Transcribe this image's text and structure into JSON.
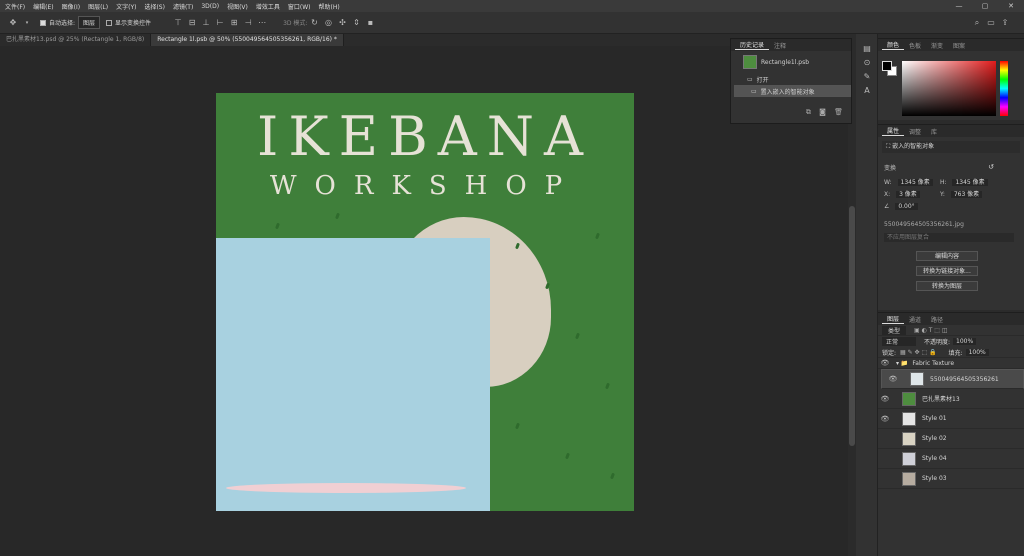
{
  "menu": [
    "文件(F)",
    "编辑(E)",
    "图像(I)",
    "图层(L)",
    "文字(Y)",
    "选择(S)",
    "滤镜(T)",
    "3D(D)",
    "视图(V)",
    "增效工具",
    "窗口(W)",
    "帮助(H)"
  ],
  "window_controls": [
    "—",
    "▢",
    "✕"
  ],
  "options": {
    "auto_select_label": "自动选择:",
    "auto_select_value": "图层",
    "show_transform_label": "显示变换控件",
    "mode_label": "3D 模式:"
  },
  "tabs": [
    {
      "label": "巴扎黑素材13.psd @ 25% (Rectangle 1, RGB/8)",
      "active": false
    },
    {
      "label": "Rectangle 1l.psb @ 50% (550049564505356261, RGB/16) *",
      "active": true
    }
  ],
  "canvas": {
    "title_line1": "IKEBANA",
    "title_line2": "WORKSHOP"
  },
  "history": {
    "tabs": [
      "历史记录",
      "注释"
    ],
    "snapshot": "Rectangle1l.psb",
    "items": [
      "打开",
      "置入嵌入的智能对象"
    ]
  },
  "color_panel": {
    "tabs": [
      "颜色",
      "色板",
      "渐变",
      "图案"
    ]
  },
  "properties": {
    "tabs": [
      "属性",
      "调整",
      "库"
    ],
    "type_label": "嵌入的智能对象",
    "section": "变换",
    "w_label": "W:",
    "w_value": "1345 像素",
    "h_label": "H:",
    "h_value": "1345 像素",
    "x_label": "X:",
    "x_value": "3 像素",
    "y_label": "Y:",
    "y_value": "763 像素",
    "angle_value": "0.00°",
    "file_name": "550049564505356261.jpg",
    "comp_placeholder": "不应用图层复合",
    "buttons": [
      "编辑内容",
      "转换为链接对象...",
      "转换为图层"
    ]
  },
  "layers": {
    "tabs": [
      "图层",
      "通道",
      "路径"
    ],
    "filter_label": "类型",
    "blend_mode": "正常",
    "opacity_label": "不透明度:",
    "opacity_value": "100%",
    "lock_label": "锁定:",
    "fill_label": "填充:",
    "fill_value": "100%",
    "group": "Fabric Texture",
    "items": [
      {
        "name": "550049564505356261",
        "visible": true,
        "selected": true,
        "color": "#dfe6e9"
      },
      {
        "name": "巴扎黑素材13",
        "visible": true,
        "selected": false,
        "color": "#4e8d3f"
      },
      {
        "name": "Style 01",
        "visible": true,
        "selected": false,
        "color": "#e5e5e5"
      },
      {
        "name": "Style 02",
        "visible": false,
        "selected": false,
        "color": "#d9d3c3"
      },
      {
        "name": "Style 04",
        "visible": false,
        "selected": false,
        "color": "#cfd0d8"
      },
      {
        "name": "Style 03",
        "visible": false,
        "selected": false,
        "color": "#b6aca0"
      }
    ]
  }
}
